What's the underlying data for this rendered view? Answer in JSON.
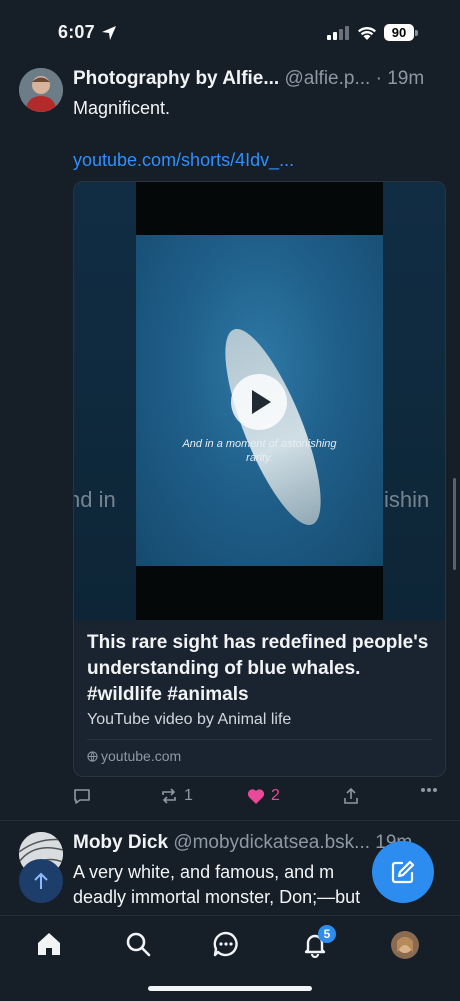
{
  "status_bar": {
    "time": "6:07",
    "battery": "90"
  },
  "post1": {
    "display_name": "Photography by Alfie...",
    "handle": "@alfie.p...",
    "time": "· 19m",
    "text": "Magnificent.",
    "link": "youtube.com/shorts/4Idv_...",
    "embed": {
      "video_caption_line1": "And in a moment of astonishing",
      "video_caption_line2": "rarity.",
      "blur_left": "nd in",
      "blur_right": "ishin",
      "title": "This rare sight has redefined people's understanding of blue whales. #wildlife #animals",
      "description": "YouTube video by Animal life",
      "domain": "youtube.com"
    },
    "actions": {
      "reposts": "1",
      "likes": "2"
    }
  },
  "post2": {
    "display_name": "Moby Dick",
    "handle": "@mobydickatsea.bsk...",
    "time": "19m",
    "text_line1": "A very white, and famous, and m",
    "text_line2": "deadly immortal monster, Don;—but"
  },
  "tabbar": {
    "notifications_badge": "5"
  },
  "colors": {
    "accent": "#2d8cf0",
    "like": "#ec4899",
    "background": "#161e27"
  }
}
